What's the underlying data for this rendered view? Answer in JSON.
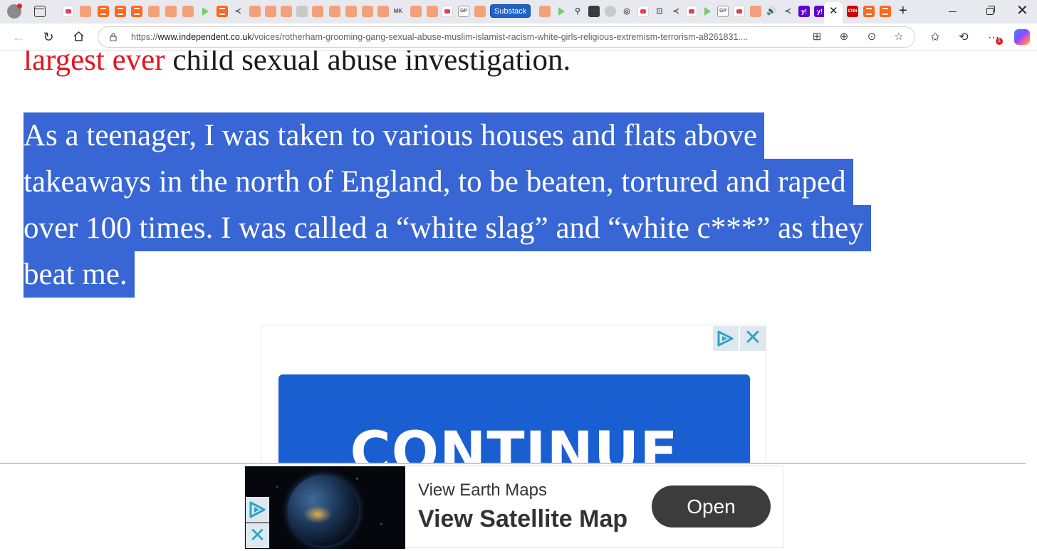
{
  "browser": {
    "tabs": {
      "active_chip_label": "Substack",
      "favicon_labels": {
        "gp": "GP",
        "yahoo": "y!",
        "cnn": "CNN",
        "mk": "MK"
      },
      "new_tab_symbol": "+",
      "close_tab_symbol": "✕",
      "close_window_symbol": "✕"
    },
    "toolbar": {
      "url_host": "www.independent.co.uk",
      "url_prefix": "https://",
      "url_path": "/voices/rotherham-grooming-gang-sexual-abuse-muslim-islamist-racism-white-girls-religious-extremism-terrorism-a8261831....",
      "more_menu_symbol": "···",
      "notification_count": "1"
    }
  },
  "article": {
    "top_line_link": "largest ever",
    "top_line_rest": " child sexual abuse investigation.",
    "quote_lines": [
      "As a teenager, I was taken to various houses and flats above",
      "takeaways in the north of England, to be beaten, tortured and raped",
      "over 100 times. I was called a “white slag” and “white c***” as they",
      "beat me."
    ]
  },
  "mid_ad": {
    "button_label": "CONTINUE",
    "close_symbol": "✕"
  },
  "sticky_ad": {
    "eyebrow": "View Earth Maps",
    "headline": "View Satellite Map",
    "cta_label": "Open",
    "close_symbol": "✕"
  },
  "colors": {
    "link_red": "#e3141f",
    "selection_blue": "#3866d4",
    "continue_blue": "#1a5fd1",
    "adchoices_cyan": "#2ba4c9"
  }
}
